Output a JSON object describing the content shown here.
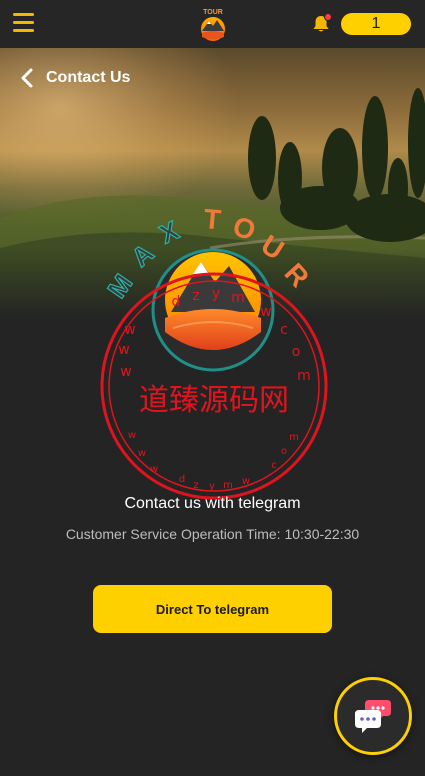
{
  "header": {
    "menu_icon": "hamburger-menu-icon",
    "logo_text": "MAX TOUR",
    "notification_icon": "bell-icon",
    "balance": "1"
  },
  "page": {
    "back_icon": "chevron-left-icon",
    "title": "Contact Us"
  },
  "hero": {
    "logo_text": "MAX TOUR"
  },
  "watermark": {
    "center_text": "道臻源码网",
    "ring_text": "www.dzym.com"
  },
  "contact": {
    "heading": "Contact us with telegram",
    "service_time": "Customer Service Operation Time: 10:30-22:30",
    "button_label": "Direct To telegram"
  },
  "chat": {
    "icon": "chat-bubbles-icon"
  },
  "colors": {
    "accent": "#ffd000",
    "background": "#242424",
    "stamp_red": "#e0141e"
  }
}
